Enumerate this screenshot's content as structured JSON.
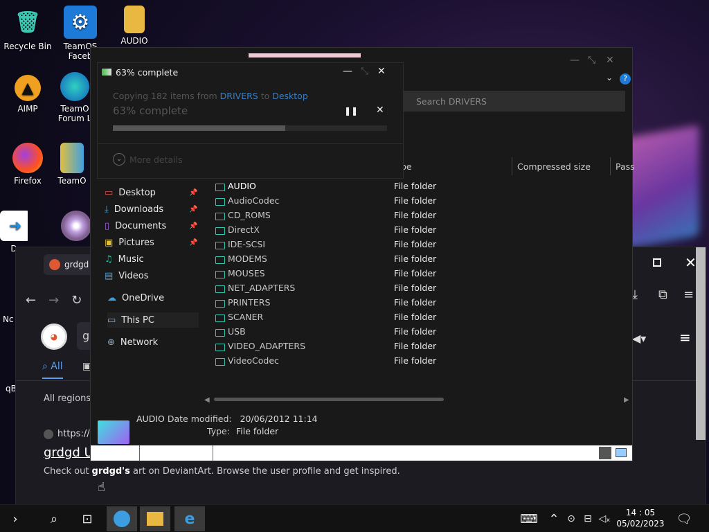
{
  "desktop": {
    "icons": [
      {
        "label": "Recycle Bin",
        "glyph": "🗑"
      },
      {
        "label": "TeamOS Faceb",
        "glyph": "⚙"
      },
      {
        "label": "AUDIO",
        "glyph": "📁"
      },
      {
        "label": "AIMP",
        "glyph": "▲"
      },
      {
        "label": "TeamO Forum L",
        "glyph": "◐"
      },
      {
        "label": "Firefox",
        "glyph": "◉"
      },
      {
        "label": "TeamO",
        "glyph": "▦"
      },
      {
        "label": "D",
        "glyph": "➜"
      },
      {
        "label": "Nc",
        "glyph": "▮"
      },
      {
        "label": "qB",
        "glyph": "◑"
      }
    ]
  },
  "browser": {
    "tab_title": "grdgd a",
    "search_query": "gr",
    "filter_all": "All",
    "regions": "All regions",
    "result_url": "https://",
    "result_title": "grdgd U",
    "result_snippet_pre": "Check out ",
    "result_snippet_bold": "grdgd's",
    "result_snippet_post": " art on DeviantArt. Browse the user profile and get inspired."
  },
  "explorer": {
    "search_placeholder": "Search DRIVERS",
    "columns": {
      "type": "pe",
      "compressed": "Compressed size",
      "pass": "Pass"
    },
    "sidebar": [
      {
        "label": "Desktop",
        "pinned": true
      },
      {
        "label": "Downloads",
        "pinned": true
      },
      {
        "label": "Documents",
        "pinned": true
      },
      {
        "label": "Pictures",
        "pinned": true
      },
      {
        "label": "Music",
        "pinned": false
      },
      {
        "label": "Videos",
        "pinned": false
      },
      {
        "label": "OneDrive",
        "pinned": false
      },
      {
        "label": "This PC",
        "pinned": false
      },
      {
        "label": "Network",
        "pinned": false
      }
    ],
    "files": [
      {
        "name": "AUDIO",
        "type": "File folder"
      },
      {
        "name": "AudioCodec",
        "type": "File folder"
      },
      {
        "name": "CD_ROMS",
        "type": "File folder"
      },
      {
        "name": "DirectX",
        "type": "File folder"
      },
      {
        "name": "IDE-SCSI",
        "type": "File folder"
      },
      {
        "name": "MODEMS",
        "type": "File folder"
      },
      {
        "name": "MOUSES",
        "type": "File folder"
      },
      {
        "name": "NET_ADAPTERS",
        "type": "File folder"
      },
      {
        "name": "PRINTERS",
        "type": "File folder"
      },
      {
        "name": "SCANER",
        "type": "File folder"
      },
      {
        "name": "USB",
        "type": "File folder"
      },
      {
        "name": "VIDEO_ADAPTERS",
        "type": "File folder"
      },
      {
        "name": "VideoCodec",
        "type": "File folder"
      }
    ],
    "details": {
      "name": "AUDIO",
      "modified_label": "Date modified:",
      "modified": "20/06/2012 11:14",
      "type_label": "Type:",
      "type": "File folder"
    }
  },
  "copy_dialog": {
    "title": "63% complete",
    "copying_pre": "Copying 182 items from ",
    "from": "DRIVERS",
    "to_word": " to ",
    "to": "Desktop",
    "progress_text": "63% complete",
    "progress": 0.63,
    "more_details": "More details"
  },
  "taskbar": {
    "time": "14 : 05",
    "date": "05/02/2023"
  },
  "colors": {
    "accent": "#3c9ee0",
    "folder": "#34c8b0"
  }
}
